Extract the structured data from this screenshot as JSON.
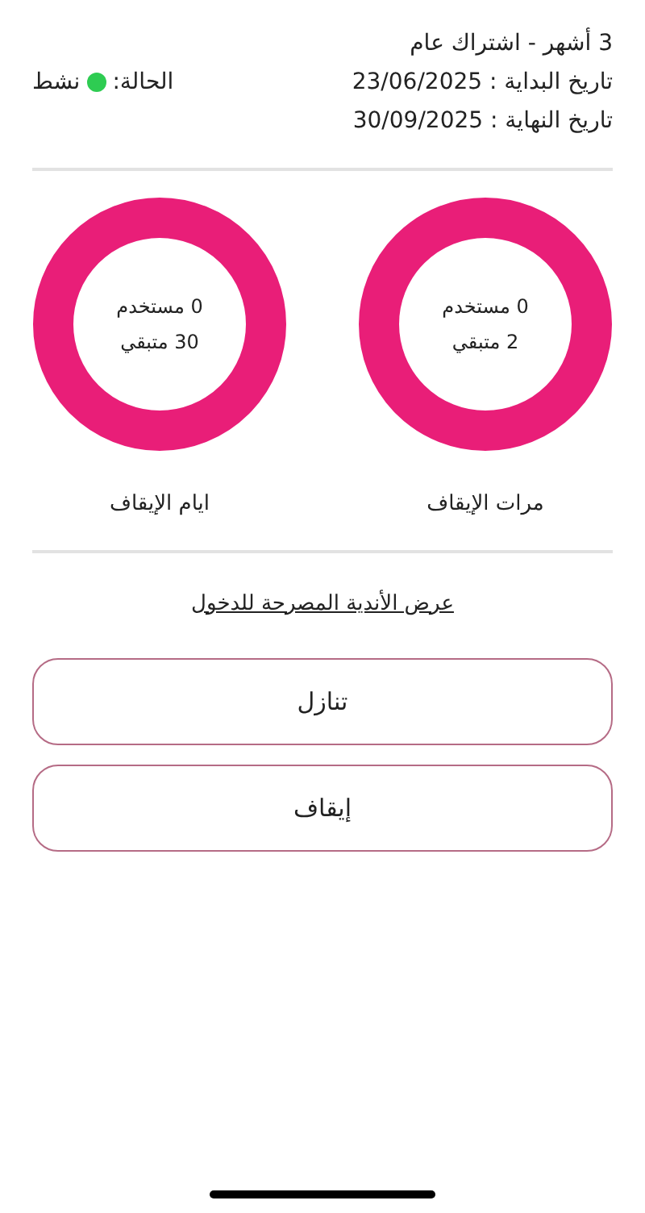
{
  "subscription": {
    "title": "3 أشهر - اشتراك عام",
    "start_date": "تاريخ البداية : 23/06/2025",
    "end_date": "تاريخ النهاية : 30/09/2025"
  },
  "status": {
    "label": "الحالة:",
    "value": "نشط",
    "active": true
  },
  "rings": [
    {
      "used": "0 مستخدم",
      "remaining": "2 متبقي",
      "caption": "مرات الإيقاف"
    },
    {
      "used": "0 مستخدم",
      "remaining": "30 متبقي",
      "caption": "ايام الإيقاف"
    }
  ],
  "link": "عرض الأندية المصرحة للدخول",
  "buttons": [
    "تنازل",
    "إيقاف"
  ]
}
